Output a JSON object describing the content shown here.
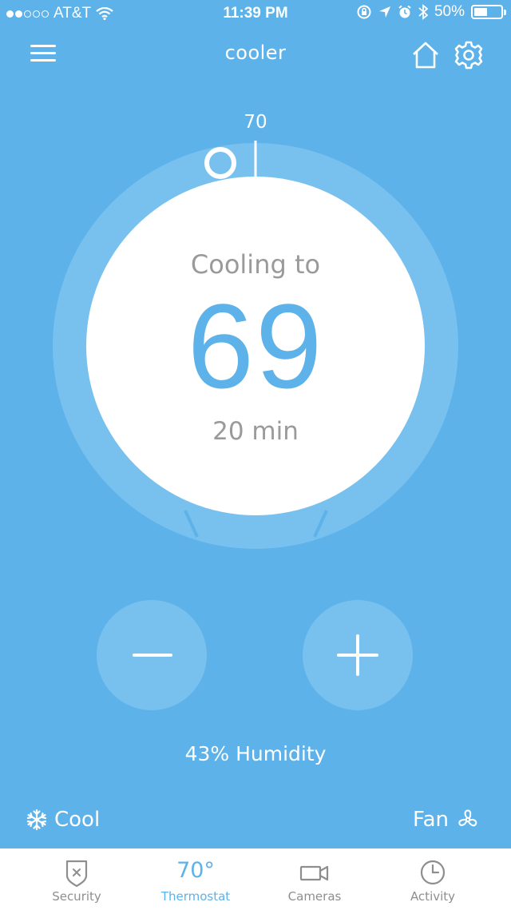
{
  "status_bar": {
    "carrier": "AT&T",
    "time": "11:39 PM",
    "battery": "50%",
    "battery_level": 0.5,
    "signal_strength": 2,
    "signal_max": 5
  },
  "header": {
    "title": "cooler",
    "menu_icon": "menu-icon",
    "home_icon": "home-icon",
    "settings_icon": "gear-icon"
  },
  "dial": {
    "setpoint_marker": "70",
    "status": "Cooling to",
    "target": "69",
    "time_remaining": "20 min"
  },
  "controls": {
    "decrease_icon": "minus-icon",
    "increase_icon": "plus-icon",
    "humidity": "43% Humidity"
  },
  "modes": {
    "cool_label": "Cool",
    "cool_icon": "snowflake-icon",
    "fan_label": "Fan",
    "fan_icon": "fan-icon"
  },
  "tabs": [
    {
      "label": "Security",
      "icon": "shield-icon",
      "active": false
    },
    {
      "label": "Thermostat",
      "value": "70°",
      "active": true
    },
    {
      "label": "Cameras",
      "icon": "camera-icon",
      "active": false
    },
    {
      "label": "Activity",
      "icon": "clock-icon",
      "active": false
    }
  ],
  "colors": {
    "background": "#5db2ea",
    "dial_track": "#78c1ef",
    "accent": "#5db2ea",
    "secondary_text": "#9a9a9a"
  }
}
